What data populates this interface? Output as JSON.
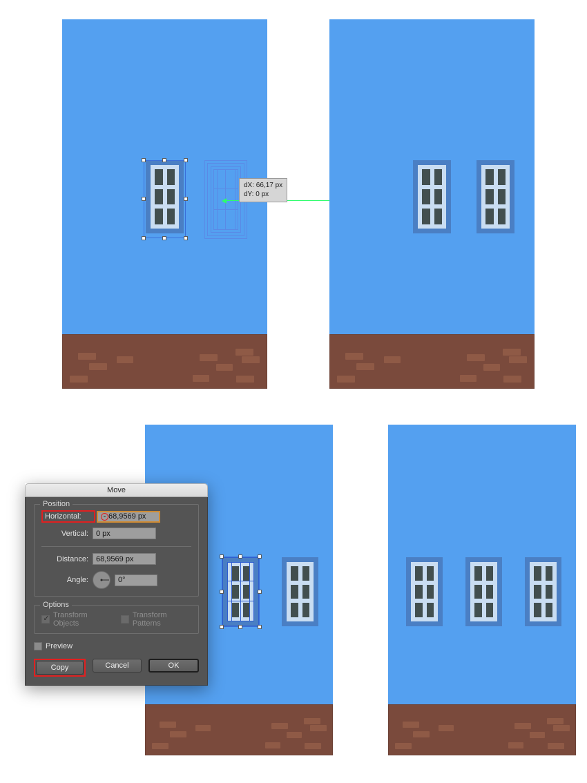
{
  "app": {
    "context": "illustrator-move-dialog-tutorial"
  },
  "measure_tooltip": {
    "dx_label": "dX: 66,17 px",
    "dy_label": "dY: 0 px"
  },
  "dialog": {
    "title": "Move",
    "position_group": {
      "legend": "Position",
      "horizontal": {
        "label": "Horizontal:",
        "value": "68,9569 px",
        "sign": "-",
        "highlighted": true
      },
      "vertical": {
        "label": "Vertical:",
        "value": "0 px"
      },
      "distance": {
        "label": "Distance:",
        "value": "68,9569 px"
      },
      "angle": {
        "label": "Angle:",
        "value": "0°",
        "dial_icon": "angle-dial-icon"
      }
    },
    "options_group": {
      "legend": "Options",
      "transform_objects": {
        "label": "Transform Objects",
        "checked": true,
        "disabled": true
      },
      "transform_patterns": {
        "label": "Transform Patterns",
        "checked": false,
        "disabled": true
      }
    },
    "preview": {
      "label": "Preview",
      "checked": false
    },
    "buttons": {
      "copy": "Copy",
      "cancel": "Cancel",
      "ok": "OK"
    }
  },
  "colors": {
    "wall_blue": "#54a0f0",
    "brick_brown": "#7a4a3c",
    "brick_light": "#8f5a46",
    "window_frame": "#4a7fc4",
    "window_inner": "#c9ddf2",
    "glass": "#424f4f",
    "smart_guide_green": "#2dfd6b",
    "highlight_red": "#e02020",
    "focus_orange": "#cf8b33",
    "dialog_bg": "#545454"
  },
  "panels": [
    {
      "name": "top-left-before",
      "windows": 1
    },
    {
      "name": "top-right-after",
      "windows": 2
    },
    {
      "name": "bottom-left-before",
      "windows": 2
    },
    {
      "name": "bottom-right-after",
      "windows": 3
    }
  ]
}
